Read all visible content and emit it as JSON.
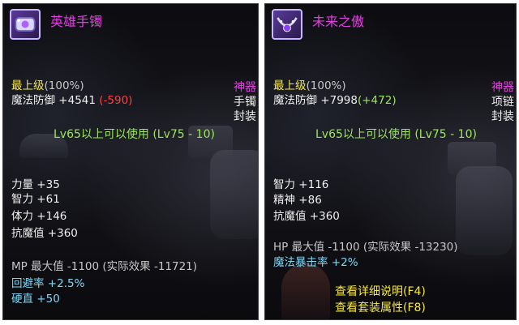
{
  "left": {
    "title": "英雄手镯",
    "grade_label": "最上级",
    "grade_pct": "(100%)",
    "type_tag": "神器",
    "defense_label": "魔法防御",
    "defense_value": "+4541",
    "defense_delta": "(-590)",
    "slot": "手镯",
    "bind": "封装",
    "level_req": "Lv65以上可以使用 (Lv75 - 10)",
    "stats": [
      {
        "name": "力量",
        "value": "+35"
      },
      {
        "name": "智力",
        "value": "+61"
      },
      {
        "name": "体力",
        "value": "+146"
      },
      {
        "name": "抗魔值",
        "value": "+360"
      }
    ],
    "bonus_grey": "MP 最大值 -1100 (实际效果 -11721)",
    "bonus_cyan": [
      {
        "name": "回避率",
        "value": "+2.5%"
      },
      {
        "name": "硬直",
        "value": "+50"
      }
    ]
  },
  "right": {
    "title": "未来之傲",
    "grade_label": "最上级",
    "grade_pct": "(100%)",
    "type_tag": "神器",
    "defense_label": "魔法防御",
    "defense_value": "+7998",
    "defense_delta": "(+472)",
    "slot": "项链",
    "bind": "封装",
    "level_req": "Lv65以上可以使用 (Lv75 - 10)",
    "stats": [
      {
        "name": "智力",
        "value": "+116"
      },
      {
        "name": "精神",
        "value": "+86"
      },
      {
        "name": "抗魔值",
        "value": "+360"
      }
    ],
    "bonus_grey": "HP 最大值 -1100 (实际效果 -13230)",
    "bonus_cyan": [
      {
        "name": "魔法暴击率",
        "value": "+2%"
      }
    ],
    "footer": [
      "查看详细说明(F4)",
      "查看套装属性(F8)"
    ]
  },
  "colors": {
    "title": "#e040e0",
    "grade": "#f5e64a",
    "level_req": "#9be85b",
    "bonus": "#7fd7f5",
    "negative": "#ff4040",
    "positive": "#9be85b"
  },
  "icons": {
    "left": "bracelet-icon",
    "right": "necklace-icon"
  }
}
